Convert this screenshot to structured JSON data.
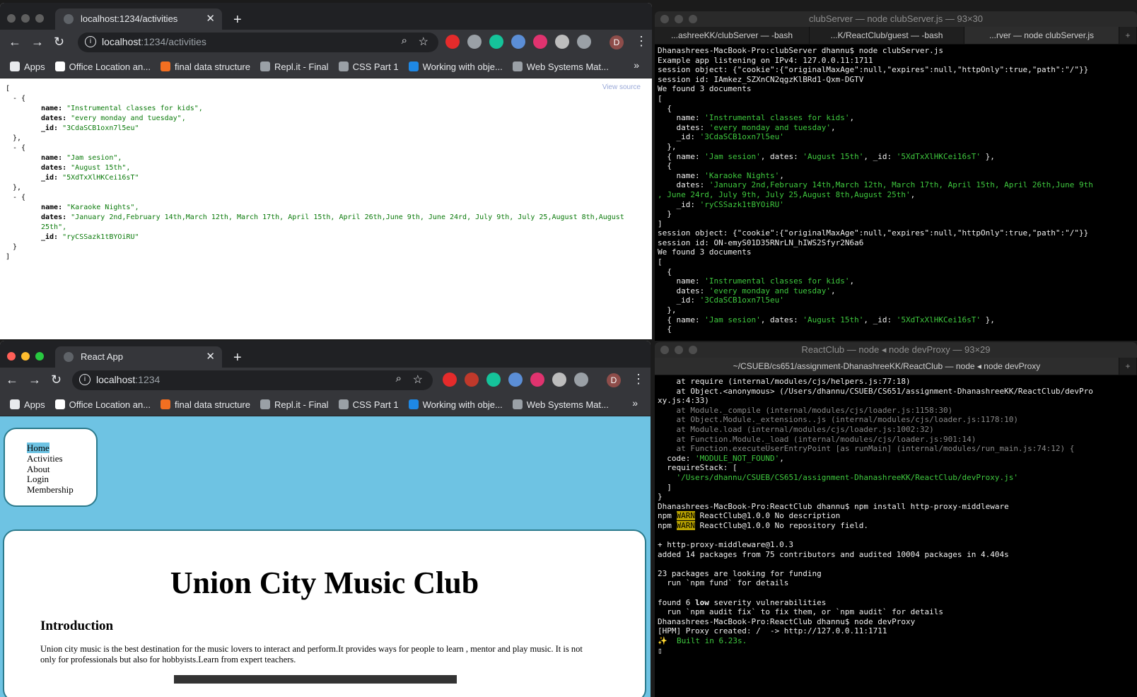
{
  "top_browser": {
    "tab_title": "localhost:1234/activities",
    "url_host": "localhost",
    "url_path": ":1234/activities",
    "view_source": "View source",
    "json_lines": [
      {
        "t": "["
      },
      {
        "t": "- {",
        "cls": "ind1"
      },
      {
        "k": "name",
        "v": "\"Instrumental classes for kids\","
      },
      {
        "k": "dates",
        "v": "\"every monday and tuesday\","
      },
      {
        "k": "_id",
        "v": "\"3CdaSCB1oxn7l5eu\""
      },
      {
        "t": "},",
        "cls": "ind1"
      },
      {
        "t": "- {",
        "cls": "ind1"
      },
      {
        "k": "name",
        "v": "\"Jam sesion\","
      },
      {
        "k": "dates",
        "v": "\"August 15th\","
      },
      {
        "k": "_id",
        "v": "\"5XdTxXlHKCei16sT\""
      },
      {
        "t": "},",
        "cls": "ind1"
      },
      {
        "t": "- {",
        "cls": "ind1"
      },
      {
        "k": "name",
        "v": "\"Karaoke Nights\","
      },
      {
        "k": "dates",
        "v": "\"January 2nd,February 14th,March 12th, March 17th, April 15th, April 26th,June 9th, June 24rd, July 9th, July 25,August 8th,August 25th\","
      },
      {
        "k": "_id",
        "v": "\"ryCSSazk1tBYOiRU\""
      },
      {
        "t": "}",
        "cls": "ind1"
      },
      {
        "t": "]"
      }
    ]
  },
  "bottom_browser": {
    "tab_title": "React App",
    "url_host": "localhost",
    "url_path": ":1234",
    "nav_items": [
      "Home",
      "Activities",
      "About",
      "Login",
      "Membership"
    ],
    "heading": "Union City Music Club",
    "subheading": "Introduction",
    "intro": "Union city music is the best destination for the music lovers to interact and perform.It provides ways for people to learn , mentor and play music. It is not only for professionals but also for hobbyists.Learn from expert teachers."
  },
  "bookmarks": [
    {
      "label": "Apps",
      "color": "#e8eaed"
    },
    {
      "label": "Office Location an...",
      "color": "#ffffff"
    },
    {
      "label": "final data structure",
      "color": "#f36f21"
    },
    {
      "label": "Repl.it - Final",
      "color": "#9aa0a6"
    },
    {
      "label": "CSS Part 1",
      "color": "#9aa0a6"
    },
    {
      "label": "Working with obje...",
      "color": "#1e88e5"
    },
    {
      "label": "Web Systems Mat...",
      "color": "#9aa0a6"
    }
  ],
  "avatar_letter": "D",
  "term_top": {
    "title": "clubServer — node clubServer.js — 93×30",
    "tabs": [
      "...ashreeKK/clubServer — -bash",
      "...K/ReactClub/guest — -bash",
      "...rver — node clubServer.js"
    ],
    "lines": [
      "Dhanashrees-MacBook-Pro:clubServer dhannu$ node clubServer.js",
      "Example app listening on IPv4: 127.0.0.11:1711",
      "session object: {\"cookie\":{\"originalMaxAge\":null,\"expires\":null,\"httpOnly\":true,\"path\":\"/\"}}",
      "session id: IAmkez_SZXnCN2qgzKlBRd1-Qxm-DGTV",
      "We found 3 documents",
      "[",
      "  {",
      "    name: |'Instrumental classes for kids'|,",
      "    dates: |'every monday and tuesday'|,",
      "    _id: |'3CdaSCB1oxn7l5eu'|",
      "  },",
      "  { name: |'Jam sesion'|, dates: |'August 15th'|, _id: |'5XdTxXlHKCei16sT'| },",
      "  {",
      "    name: |'Karaoke Nights'|,",
      "    dates: |'January 2nd,February 14th,March 12th, March 17th, April 15th, April 26th,June 9th|",
      "|, June 24rd, July 9th, July 25,August 8th,August 25th'|,",
      "    _id: |'ryCSSazk1tBYOiRU'|",
      "  }",
      "]",
      "session object: {\"cookie\":{\"originalMaxAge\":null,\"expires\":null,\"httpOnly\":true,\"path\":\"/\"}}",
      "session id: ON-emyS01D35RNrLN_hIWS2Sfyr2N6a6",
      "We found 3 documents",
      "[",
      "  {",
      "    name: |'Instrumental classes for kids'|,",
      "    dates: |'every monday and tuesday'|,",
      "    _id: |'3CdaSCB1oxn7l5eu'|",
      "  },",
      "  { name: |'Jam sesion'|, dates: |'August 15th'|, _id: |'5XdTxXlHKCei16sT'| },",
      "  {"
    ]
  },
  "term_bottom": {
    "title": "ReactClub — node ◂ node devProxy — 93×29",
    "tabs": [
      "~/CSUEB/cs651/assignment-DhanashreeKK/ReactClub — node ◂ node devProxy"
    ],
    "lines": [
      "    at require (internal/modules/cjs/helpers.js:77:18)",
      "    at Object.<anonymous> (/Users/dhannu/CSUEB/CS651/assignment-DhanashreeKK/ReactClub/devPro",
      "xy.js:4:33)",
      "~    at Module._compile (internal/modules/cjs/loader.js:1158:30)",
      "~    at Object.Module._extensions..js (internal/modules/cjs/loader.js:1178:10)",
      "~    at Module.load (internal/modules/cjs/loader.js:1002:32)",
      "~    at Function.Module._load (internal/modules/cjs/loader.js:901:14)",
      "~    at Function.executeUserEntryPoint [as runMain] (internal/modules/run_main.js:74:12) {",
      "  code: |'MODULE_NOT_FOUND'|,",
      "  requireStack: [",
      "    |'/Users/dhannu/CSUEB/CS651/assignment-DhanashreeKK/ReactClub/devProxy.js'|",
      "  ]",
      "}",
      "Dhanashrees-MacBook-Pro:ReactClub dhannu$ npm install http-proxy-middleware",
      "npm ^WARN^ ReactClub@1.0.0 No description",
      "npm ^WARN^ ReactClub@1.0.0 No repository field.",
      "",
      "+ http-proxy-middleware@1.0.3",
      "added 14 packages from 75 contributors and audited 10004 packages in 4.404s",
      "",
      "23 packages are looking for funding",
      "  run `npm fund` for details",
      "",
      "found 6 *low* severity vulnerabilities",
      "  run `npm audit fix` to fix them, or `npm audit` for details",
      "Dhanashrees-MacBook-Pro:ReactClub dhannu$ node devProxy",
      "[HPM] Proxy created: /  -> http://127.0.0.11:1711",
      "|✨  Built in 6.23s.|",
      "▯"
    ]
  }
}
